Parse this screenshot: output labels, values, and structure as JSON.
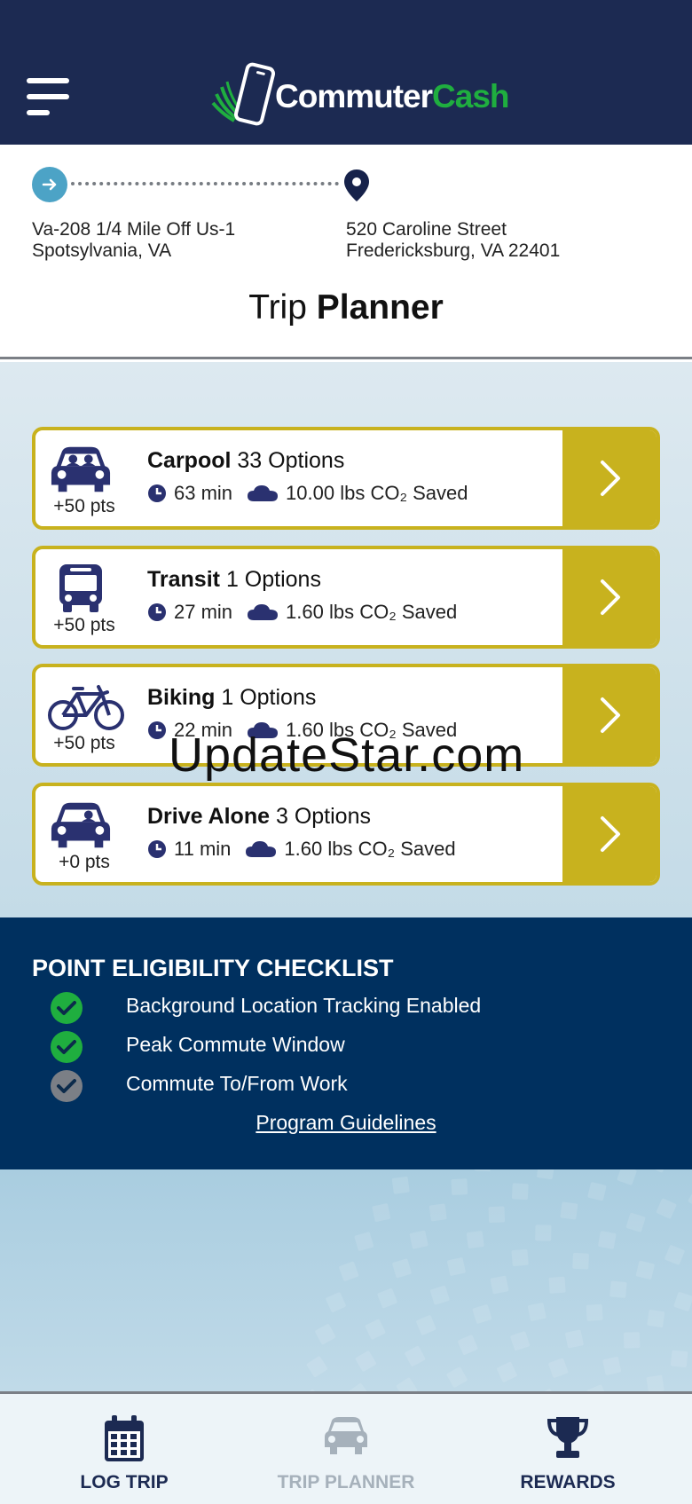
{
  "app": {
    "logo_part1": "Commuter",
    "logo_part2": "Cash",
    "accent_gold": "#c8b21e",
    "navy": "#1c2a52",
    "checklist_bg": "#00305f",
    "check_green": "#1fae3f"
  },
  "route": {
    "origin_line1": "Va-208 1/4 Mile Off Us-1",
    "origin_line2": "Spotsylvania, VA",
    "dest_line1": "520 Caroline Street",
    "dest_line2": "Fredericksburg, VA 22401"
  },
  "page_title": {
    "light": "Trip ",
    "bold": "Planner"
  },
  "options": [
    {
      "mode": "Carpool",
      "count": "33 Options",
      "time": "63 min",
      "co2": "10.00 lbs CO₂ Saved",
      "points": "+50 pts",
      "icon": "carpool-car-icon"
    },
    {
      "mode": "Transit",
      "count": "1 Options",
      "time": "27 min",
      "co2": "1.60 lbs CO₂ Saved",
      "points": "+50 pts",
      "icon": "bus-icon"
    },
    {
      "mode": "Biking",
      "count": "1 Options",
      "time": "22 min",
      "co2": "1.60 lbs CO₂ Saved",
      "points": "+50 pts",
      "icon": "bicycle-icon"
    },
    {
      "mode": "Drive Alone",
      "count": "3 Options",
      "time": "11 min",
      "co2": "1.60 lbs CO₂ Saved",
      "points": "+0 pts",
      "icon": "drive-alone-car-icon"
    }
  ],
  "watermark": "UpdateStar.com",
  "checklist": {
    "title": "POINT ELIGIBILITY CHECKLIST",
    "items": [
      {
        "label": "Background Location Tracking Enabled",
        "status": "checked",
        "color": "#1fae3f"
      },
      {
        "label": "Peak Commute Window",
        "status": "checked",
        "color": "#1fae3f"
      },
      {
        "label": "Commute To/From Work",
        "status": "unchecked",
        "color": "#7b7f86"
      }
    ],
    "link": "Program Guidelines"
  },
  "bottom_nav": {
    "items": [
      {
        "label": "LOG TRIP",
        "icon": "calendar-icon",
        "state": "active"
      },
      {
        "label": "TRIP PLANNER",
        "icon": "car-icon",
        "state": "current-dimmed"
      },
      {
        "label": "REWARDS",
        "icon": "trophy-icon",
        "state": "active"
      }
    ]
  }
}
